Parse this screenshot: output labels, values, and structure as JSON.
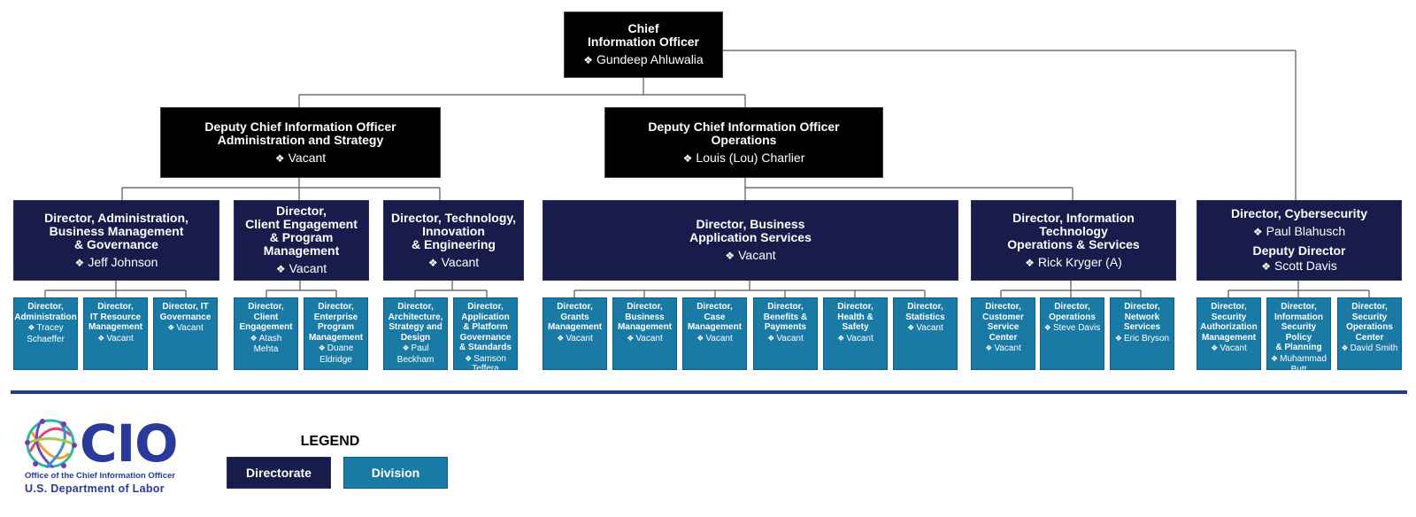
{
  "colors": {
    "executive": "#000000",
    "directorate": "#171c4a",
    "division": "#1a7aa6",
    "rule": "#253b96",
    "logo_text": "#2a3a9b"
  },
  "cio": {
    "title_line1": "Chief",
    "title_line2": "Information Officer",
    "name": "Gundeep Ahluwalia"
  },
  "deputies": [
    {
      "title_line1": "Deputy Chief Information Officer",
      "title_line2": "Administration and Strategy",
      "name": "Vacant"
    },
    {
      "title_line1": "Deputy Chief Information Officer",
      "title_line2": "Operations",
      "name": "Louis (Lou) Charlier"
    }
  ],
  "directorates": [
    {
      "title_lines": [
        "Director, Administration,",
        "Business Management",
        "& Governance"
      ],
      "name": "Jeff Johnson",
      "divisions": [
        {
          "title_lines": [
            "Director,",
            "Administration"
          ],
          "name_lines": [
            "Tracey",
            "Schaeffer"
          ]
        },
        {
          "title_lines": [
            "Director,",
            "IT Resource",
            "Management"
          ],
          "name_lines": [
            "Vacant"
          ]
        },
        {
          "title_lines": [
            "Director, IT",
            "Governance"
          ],
          "name_lines": [
            "Vacant"
          ]
        }
      ]
    },
    {
      "title_lines": [
        "Director,",
        "Client Engagement",
        "& Program",
        "Management"
      ],
      "name": "Vacant",
      "divisions": [
        {
          "title_lines": [
            "Director,",
            "Client",
            "Engagement"
          ],
          "name_lines": [
            "Atash",
            "Mehta"
          ]
        },
        {
          "title_lines": [
            "Director,",
            "Enterprise",
            "Program",
            "Management"
          ],
          "name_lines": [
            "Duane",
            "Eldridge"
          ]
        }
      ]
    },
    {
      "title_lines": [
        "Director, Technology,",
        "Innovation",
        "& Engineering"
      ],
      "name": "Vacant",
      "divisions": [
        {
          "title_lines": [
            "Director,",
            "Architecture,",
            "Strategy and",
            "Design"
          ],
          "name_lines": [
            "Paul",
            "Beckham"
          ]
        },
        {
          "title_lines": [
            "Director,",
            "Application",
            "& Platform",
            "Governance",
            "& Standards"
          ],
          "name_lines": [
            "Samson Teffera"
          ]
        }
      ]
    },
    {
      "title_lines": [
        "Director, Business",
        "Application Services"
      ],
      "name": "Vacant",
      "divisions": [
        {
          "title_lines": [
            "Director,",
            "Grants",
            "Management"
          ],
          "name_lines": [
            "Vacant"
          ]
        },
        {
          "title_lines": [
            "Director,",
            "Business",
            "Management"
          ],
          "name_lines": [
            "Vacant"
          ]
        },
        {
          "title_lines": [
            "Director,",
            "Case",
            "Management"
          ],
          "name_lines": [
            "Vacant"
          ]
        },
        {
          "title_lines": [
            "Director,",
            "Benefits &",
            "Payments"
          ],
          "name_lines": [
            "Vacant"
          ]
        },
        {
          "title_lines": [
            "Director,",
            "Health &",
            "Safety"
          ],
          "name_lines": [
            "Vacant"
          ]
        },
        {
          "title_lines": [
            "Director,",
            "Statistics"
          ],
          "name_lines": [
            "Vacant"
          ]
        }
      ]
    },
    {
      "title_lines": [
        "Director, Information",
        "Technology",
        "Operations & Services"
      ],
      "name": "Rick Kryger (A)",
      "divisions": [
        {
          "title_lines": [
            "Director,",
            "Customer",
            "Service",
            "Center"
          ],
          "name_lines": [
            "Vacant"
          ]
        },
        {
          "title_lines": [
            "Director,",
            "Operations"
          ],
          "name_lines": [
            "Steve Davis"
          ]
        },
        {
          "title_lines": [
            "Director,",
            "Network",
            "Services"
          ],
          "name_lines": [
            "Eric Bryson"
          ]
        }
      ]
    },
    {
      "title_lines": [
        "Director, Cybersecurity"
      ],
      "name": "Paul Blahusch",
      "deputy_title": "Deputy Director",
      "deputy_name": "Scott Davis",
      "divisions": [
        {
          "title_lines": [
            "Director,",
            "Security",
            "Authorization",
            "Management"
          ],
          "name_lines": [
            "Vacant"
          ]
        },
        {
          "title_lines": [
            "Director,",
            "Information",
            "Security Policy",
            "& Planning"
          ],
          "name_lines": [
            "Muhammad",
            "Butt"
          ]
        },
        {
          "title_lines": [
            "Director,",
            "Security",
            "Operations",
            "Center"
          ],
          "name_lines": [
            "David Smith"
          ]
        }
      ]
    }
  ],
  "logo": {
    "mark": "CIO",
    "subtitle": "Office of the Chief Information Officer",
    "department": "U.S. Department of Labor"
  },
  "legend": {
    "title": "LEGEND",
    "directorate_label": "Directorate",
    "division_label": "Division"
  },
  "icons": {
    "bullet": "❖"
  }
}
